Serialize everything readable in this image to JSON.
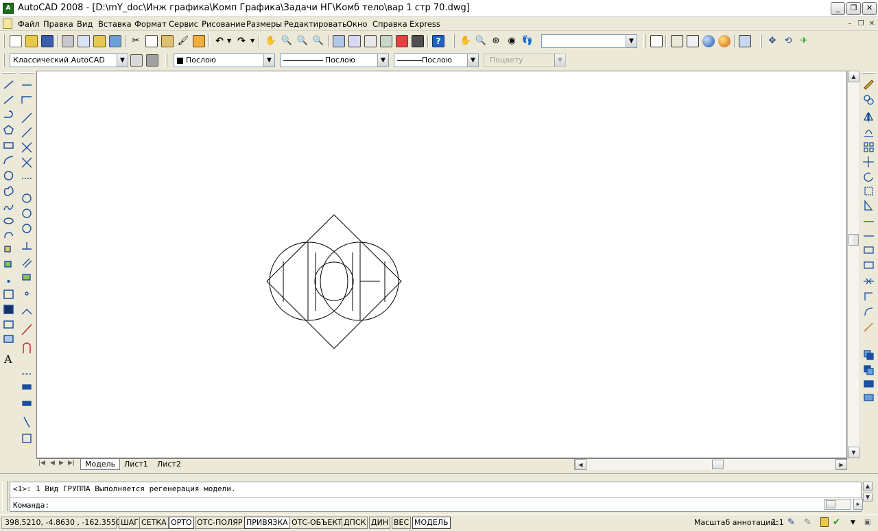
{
  "window": {
    "title": "AutoCAD 2008 - [D:\\mY_doc\\Инж графика\\Комп Графика\\Задачи НГ\\Комб тело\\вар 1 стр 70.dwg]",
    "minimize": "_",
    "maximize": "❐",
    "close": "✕"
  },
  "menu": {
    "items": [
      "Файл",
      "Правка",
      "Вид",
      "Вставка",
      "Формат",
      "Сервис",
      "Рисование",
      "Размеры",
      "Редактировать",
      "Окно",
      "Справка",
      "Express"
    ],
    "doc_minimize": "–",
    "doc_restore": "❐",
    "doc_close": "✕"
  },
  "toolbar": {
    "named_view_value": "",
    "workspace": "Классический AutoCAD",
    "color": "Послою",
    "linetype": "Послою",
    "lineweight": "Послою",
    "plotstyle": "Поцвету",
    "dropdown_arrow": "▼"
  },
  "tabs": {
    "nav_first": "|◀",
    "nav_prev": "◀",
    "nav_next": "▶",
    "nav_last": "▶|",
    "model": "Модель",
    "layout1": "Лист1",
    "layout2": "Лист2"
  },
  "command": {
    "history": "<1>: 1 Вид ГРУППА Выполняется регенерация модели.",
    "prompt": "Команда:"
  },
  "status": {
    "coordinates": "398.5210, -4.8630 , -162.3550",
    "toggles": [
      {
        "label": "ШАГ",
        "on": false
      },
      {
        "label": "СЕТКА",
        "on": false
      },
      {
        "label": "ОРТО",
        "on": true
      },
      {
        "label": "ОТС-ПОЛЯР",
        "on": false
      },
      {
        "label": "ПРИВЯЗКА",
        "on": true
      },
      {
        "label": "ОТС-ОБЪЕКТ",
        "on": false
      },
      {
        "label": "ДПСК",
        "on": false
      },
      {
        "label": "ДИН",
        "on": false
      },
      {
        "label": "ВЕС",
        "on": false
      },
      {
        "label": "МОДЕЛЬ",
        "on": true
      }
    ],
    "annotation_scale_label": "Масштаб аннотаций:",
    "annotation_scale_value": "1:1"
  },
  "colors": {
    "toolbar_bg": "#ece9d8",
    "canvas_bg": "#ffffff",
    "drawing_stroke": "#000000"
  }
}
